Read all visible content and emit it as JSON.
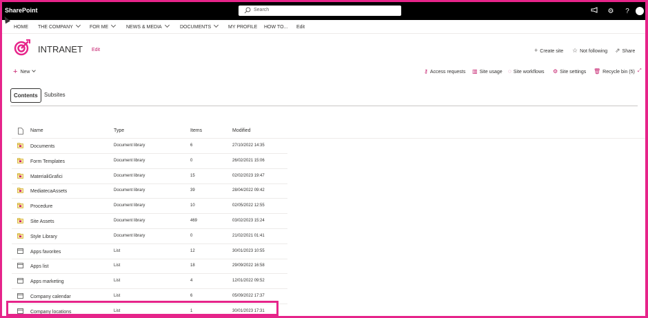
{
  "suite": {
    "brand": "SharePoint",
    "search_placeholder": "Search",
    "icons": [
      "megaphone-icon",
      "gear-icon",
      "help-icon",
      "avatar"
    ]
  },
  "nav": {
    "items": [
      {
        "label": "HOME",
        "has_menu": false
      },
      {
        "label": "THE COMPANY",
        "has_menu": true
      },
      {
        "label": "FOR ME",
        "has_menu": true
      },
      {
        "label": "NEWS & MEDIA",
        "has_menu": true
      },
      {
        "label": "DOCUMENTS",
        "has_menu": true
      },
      {
        "label": "MY PROFILE",
        "has_menu": false
      },
      {
        "label": "HOW TO...",
        "has_menu": false
      },
      {
        "label": "Edit",
        "has_menu": false
      }
    ]
  },
  "site": {
    "title": "INTRANET",
    "edit_label": "Edit",
    "create_site": "Create site",
    "follow": "Not following",
    "share": "Share",
    "accent_color": "#c41a6a"
  },
  "commands": {
    "new": "New",
    "access_requests": "Access requests",
    "site_usage": "Site usage",
    "site_workflows": "Site workflows",
    "site_settings": "Site settings",
    "recycle_bin": "Recycle bin (5)"
  },
  "tabs": {
    "contents": "Contents",
    "subsites": "Subsites"
  },
  "table": {
    "headers": {
      "name": "Name",
      "type": "Type",
      "items": "Items",
      "modified": "Modified"
    },
    "rows": [
      {
        "name": "Documents",
        "type": "Document library",
        "items": "6",
        "modified": "27/10/2022 14:35",
        "icon": "library"
      },
      {
        "name": "Form Templates",
        "type": "Document library",
        "items": "0",
        "modified": "26/02/2021 15:06",
        "icon": "library"
      },
      {
        "name": "MaterialiGrafici",
        "type": "Document library",
        "items": "15",
        "modified": "02/02/2023 19:47",
        "icon": "library"
      },
      {
        "name": "MediatecaAssets",
        "type": "Document library",
        "items": "39",
        "modified": "28/04/2022 09:42",
        "icon": "library"
      },
      {
        "name": "Procedure",
        "type": "Document library",
        "items": "10",
        "modified": "02/05/2022 12:55",
        "icon": "library"
      },
      {
        "name": "Site Assets",
        "type": "Document library",
        "items": "469",
        "modified": "03/02/2023 15:24",
        "icon": "library"
      },
      {
        "name": "Style Library",
        "type": "Document library",
        "items": "0",
        "modified": "21/02/2021 01:41",
        "icon": "library"
      },
      {
        "name": "Apps favorites",
        "type": "List",
        "items": "12",
        "modified": "30/01/2023 10:55",
        "icon": "list"
      },
      {
        "name": "Apps list",
        "type": "List",
        "items": "18",
        "modified": "29/09/2022 16:58",
        "icon": "list"
      },
      {
        "name": "Apps marketing",
        "type": "List",
        "items": "4",
        "modified": "12/01/2022 09:52",
        "icon": "list"
      },
      {
        "name": "Company calendar",
        "type": "List",
        "items": "6",
        "modified": "05/09/2022 17:37",
        "icon": "list"
      },
      {
        "name": "Company locations",
        "type": "List",
        "items": "1",
        "modified": "30/01/2023 17:31",
        "icon": "list"
      }
    ]
  }
}
